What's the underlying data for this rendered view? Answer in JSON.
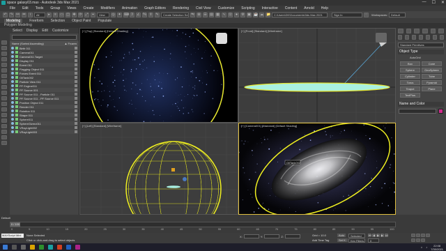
{
  "window": {
    "title": "space galaxy03.max - Autodesk 3ds Max 2021",
    "controls": [
      "—",
      "☐",
      "✕"
    ]
  },
  "menu": [
    "File",
    "Edit",
    "Tools",
    "Group",
    "Views",
    "Create",
    "Modifiers",
    "Animation",
    "Graph Editors",
    "Rendering",
    "Civil View",
    "Customize",
    "Scripting",
    "Interactive",
    "Content",
    "Arnold",
    "Help"
  ],
  "toolbar": {
    "selection_set_label": "Create Selection Set",
    "view_label": "View",
    "path_field": "C:\\Users\\DK\\Documents\\3ds Max 2021",
    "sign_in": "Sign In",
    "workspaces_label": "Workspaces:",
    "workspace_value": "Default"
  },
  "ribbon": {
    "tabs": [
      "Modeling",
      "Freeform",
      "Selection",
      "Object Paint",
      "Populate"
    ],
    "active_tab": "Modeling",
    "sub_label": "Polygon Modeling"
  },
  "scene_explorer": {
    "tabs": [
      "Select",
      "Display",
      "Edit",
      "Customize"
    ],
    "header_name": "Name (Sorted Ascending)",
    "header_frozen": "▲ Frozen",
    "items": [
      "Birth 011",
      "Camera011",
      "Camera011.Target",
      "Display 011",
      "Event 011",
      "Flagging Object 011",
      "Forces Event 011",
      "OilTank002",
      "Particle View 011",
      "PF Engine011",
      "PF Source 001",
      "PF Source 011 - Particle 011",
      "PF Source 011 - PF Source 011",
      "Position Object 011",
      "Render 011",
      "Rotation 011",
      "Shape 011",
      "Sphere011",
      "SphereGizmo011",
      "VRayLight002",
      "VRayLight003"
    ]
  },
  "viewports": [
    {
      "label": "[+] [Top] [Standard] [Default Shading]"
    },
    {
      "label": "[+] [Front] [Standard] [Wireframe]"
    },
    {
      "label": "[+] [Left] [Standard] [Wireframe]"
    },
    {
      "label": "[+] [Camera001] [Standard] [Default Shading]",
      "tag": "OilTank002"
    }
  ],
  "command_panel": {
    "category": "Standard Primitives",
    "rollout_object_type": "Object Type",
    "autogrid_label": "AutoGrid",
    "buttons": [
      "Box",
      "Cone",
      "Sphere",
      "GeoSphere",
      "Cylinder",
      "Tube",
      "Torus",
      "Pyramid",
      "Teapot",
      "Plane",
      "TextPlus"
    ],
    "rollout_name_color": "Name and Color",
    "color_swatch": "#d02a8c"
  },
  "timeline": {
    "frame_display": "0 / 100",
    "ruler": [
      "0",
      "5",
      "10",
      "15",
      "20",
      "25",
      "30",
      "35",
      "40",
      "45",
      "50",
      "55",
      "60",
      "65",
      "70",
      "75",
      "80",
      "85",
      "90",
      "95",
      "100"
    ]
  },
  "statusbar": {
    "workspace": "Default",
    "script_field": "MAXScript Mini",
    "selection_status": "None Selected",
    "prompt": "Click or click-and-drag to select objects",
    "x_label": "X:",
    "y_label": "Y:",
    "z_label": "Z:",
    "grid": "Grid = 10.0",
    "add_time_tag": "Add Time Tag",
    "auto_key": "Auto",
    "selected": "Selected",
    "set_key": "Set K.",
    "key_filters": "Key Filters...",
    "frame_value": "0"
  },
  "taskbar": {
    "time": "22:08",
    "date": "7/30/2021"
  }
}
